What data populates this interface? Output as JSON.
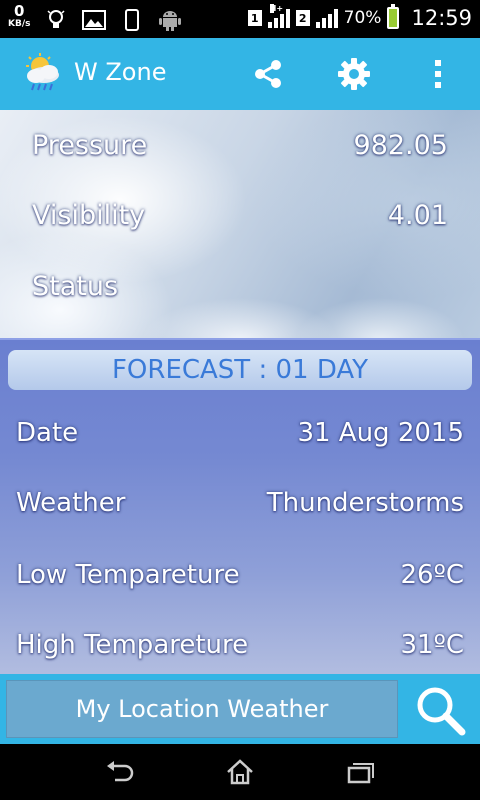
{
  "status_bar": {
    "speed_value": "0",
    "speed_unit": "KB/s",
    "sim1": "1",
    "net_type": "H+",
    "sim2": "2",
    "battery": "70%",
    "time": "12:59",
    "icons": [
      "bulb-icon",
      "image-icon",
      "phone-icon",
      "android-icon"
    ]
  },
  "app_bar": {
    "title": "W Zone",
    "accent": "#33b5e5",
    "actions": [
      "share-icon",
      "gear-icon",
      "overflow-menu-icon"
    ]
  },
  "current": {
    "rows": [
      {
        "label": "Pressure",
        "value": "982.05"
      },
      {
        "label": "Visibility",
        "value": "4.01"
      },
      {
        "label": "Status",
        "value": ""
      }
    ]
  },
  "forecast": {
    "header": "FORECAST : 01 DAY",
    "rows": [
      {
        "label": "Date",
        "value": "31 Aug 2015"
      },
      {
        "label": "Weather",
        "value": "Thunderstorms"
      },
      {
        "label": "Low Tempareture",
        "value": "26ºC"
      },
      {
        "label": "High Tempareture",
        "value": "31ºC"
      }
    ]
  },
  "bottom": {
    "button_label": "My Location Weather",
    "search_icon": "search-icon"
  },
  "nav": [
    "back-icon",
    "home-icon",
    "recents-icon"
  ]
}
